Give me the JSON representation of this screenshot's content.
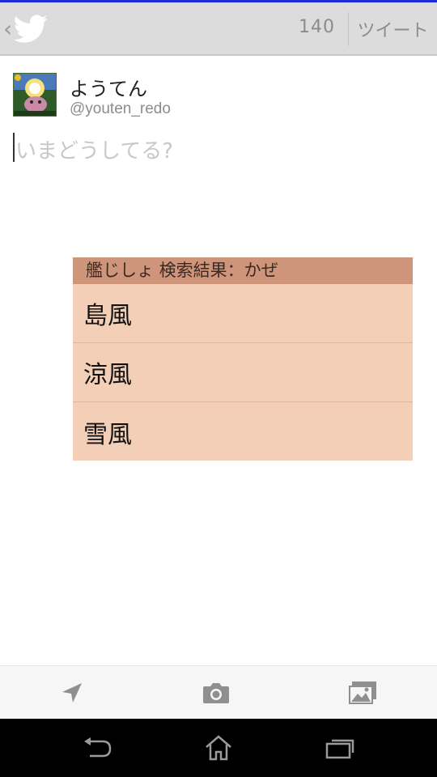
{
  "header": {
    "char_count": "140",
    "tweet_label": "ツイート",
    "up_icon": "chevron-left-icon",
    "app_icon": "twitter-bird-icon"
  },
  "profile": {
    "display_name": "ようてん",
    "screen_name": "@youten_redo"
  },
  "compose": {
    "placeholder": "いまどうしてる?"
  },
  "suggestions": {
    "header": "艦じしょ 検索結果：かぜ",
    "items": [
      "島風",
      "涼風",
      "雪風"
    ]
  },
  "toolbar": {
    "icons": [
      "location-arrow-icon",
      "camera-icon",
      "gallery-icon"
    ]
  },
  "navbar": {
    "icons": [
      "back-icon",
      "home-icon",
      "recents-icon"
    ]
  },
  "colors": {
    "action_bar": "#dcdcdc",
    "popup_header": "#cf957a",
    "popup_body": "#f2cfb6",
    "navbar": "#000000"
  }
}
